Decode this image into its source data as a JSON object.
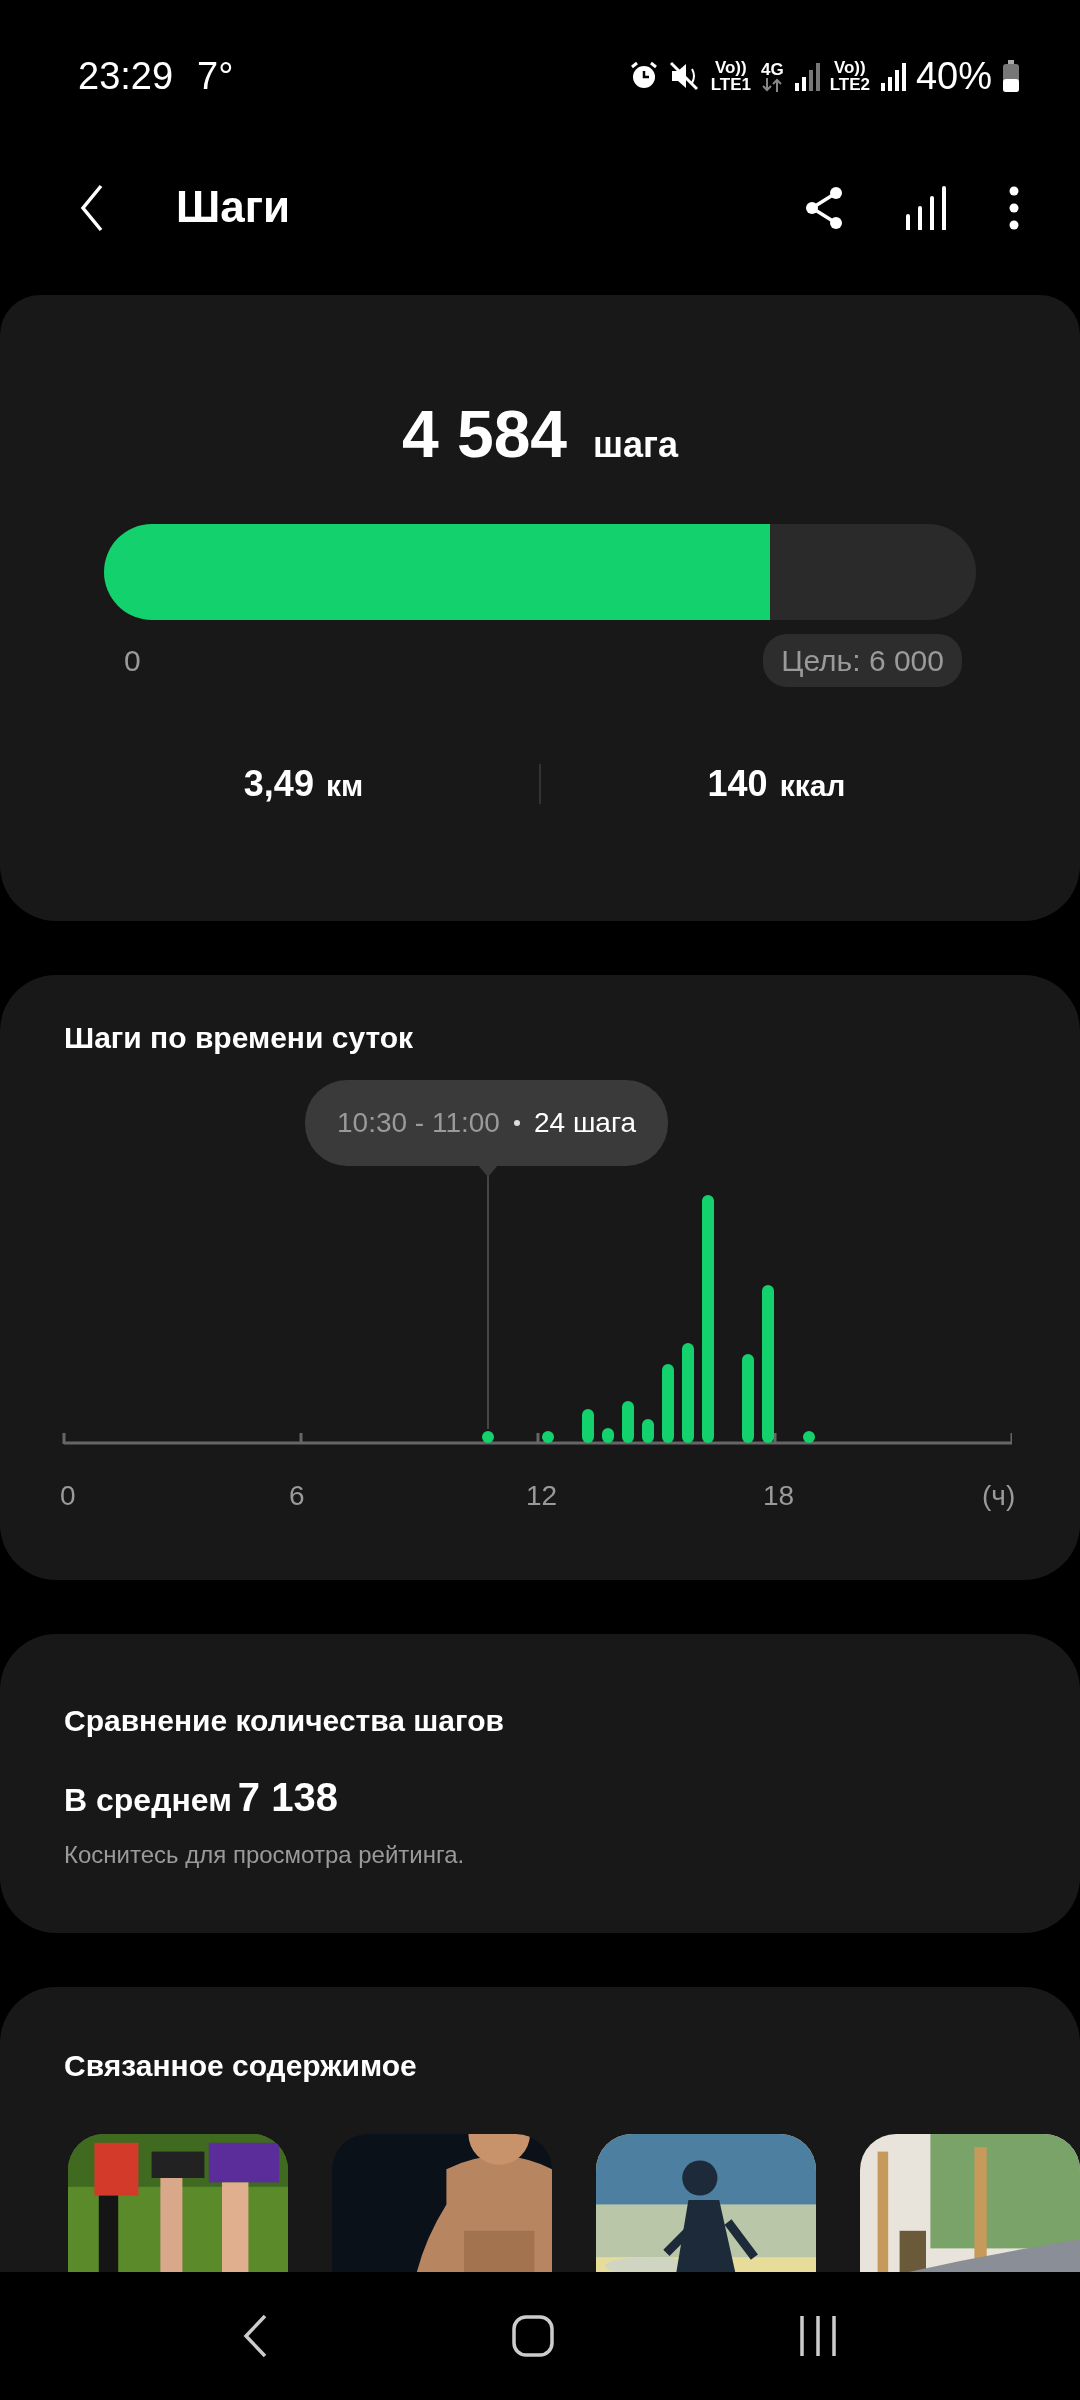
{
  "status_bar": {
    "time": "23:29",
    "temperature": "7°",
    "sim1": {
      "volte": "Vo))",
      "network": "LTE1",
      "data": "4G"
    },
    "sim2": {
      "volte": "Vo))",
      "network": "LTE2"
    },
    "battery": "40%"
  },
  "app_bar": {
    "title": "Шаги"
  },
  "summary": {
    "steps": "4 584",
    "unit": "шага",
    "level": 0.764,
    "start": "0",
    "goal": "Цель: 6 000",
    "distance": "3,49",
    "distance_unit": "км",
    "calories": "140",
    "calories_unit": "ккал"
  },
  "hourly": {
    "title": "Шаги по времени суток",
    "tooltip": {
      "range": "10:30 - 11:00",
      "value": "24 шага"
    },
    "axis_labels": [
      "0",
      "6",
      "12",
      "18",
      "(ч)"
    ]
  },
  "comparison": {
    "title": "Сравнение количества шагов",
    "label": "В среднем",
    "value": "7 138",
    "hint": "Коснитесь для просмотра рейтинга."
  },
  "related": {
    "title": "Связанное содержимое"
  }
}
